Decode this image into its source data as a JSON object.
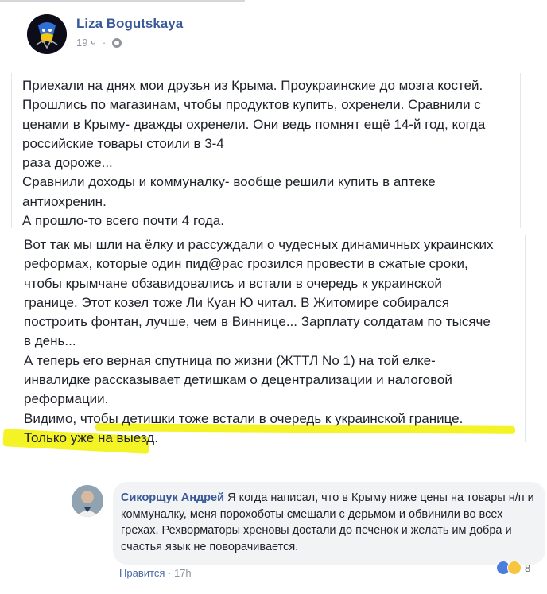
{
  "post": {
    "author": "Liza Bogutskaya",
    "time": "19 ч",
    "separator": "·",
    "paragraph_1": [
      "Приехали на днях мои друзья из Крыма. Проукраинские до мозга костей.",
      "Прошлись по магазинам, чтобы продуктов купить, охренели. Сравнили с",
      "ценами в Крыму- дважды охренели. Они ведь помнят ещё 14-й год, когда",
      "российские товары стоили в 3-4",
      "раза дороже...",
      "Сравнили доходы и коммуналку- вообще решили купить в аптеке",
      "антиохренин.",
      "А прошло-то всего почти 4 года."
    ],
    "paragraph_2": [
      "Вот так мы шли на ёлку и рассуждали о чудесных динамичных украинских",
      "реформах, которые один пид@рас грозился провести в сжатые сроки,",
      "чтобы крымчане обзавидовались и встали в очередь к украинской",
      "границе. Этот козел тоже Ли Куан Ю читал. В Житомире собирался",
      "построить фонтан, лучше, чем в Виннице... Зарплату солдатам по тысяче",
      "в день...",
      "А теперь его верная спутница по жизни (ЖТТЛ No 1) на той елке-",
      "инвалидке рассказывает детишкам о децентрализации и налоговой",
      "реформации.",
      "Видимо, чтобы детишки тоже встали в очередь к украинской границе.",
      "Только уже на выезд."
    ]
  },
  "comment": {
    "author": "Сикорщук Андрей",
    "text": "Я когда написал, что в Крыму ниже цены на товары н/п и коммуналку, меня порохоботы смешали с дерьмом и обвинили во всех грехах. Рехворматоры хреновы достали до печенок и желать им добра и счастья язык не поворачивается.",
    "like_label": "Нравится",
    "separator": "·",
    "time": "17h",
    "reaction_count": "8"
  },
  "colors": {
    "link": "#385898",
    "highlight": "#f2f20e",
    "meta": "#90949c"
  }
}
